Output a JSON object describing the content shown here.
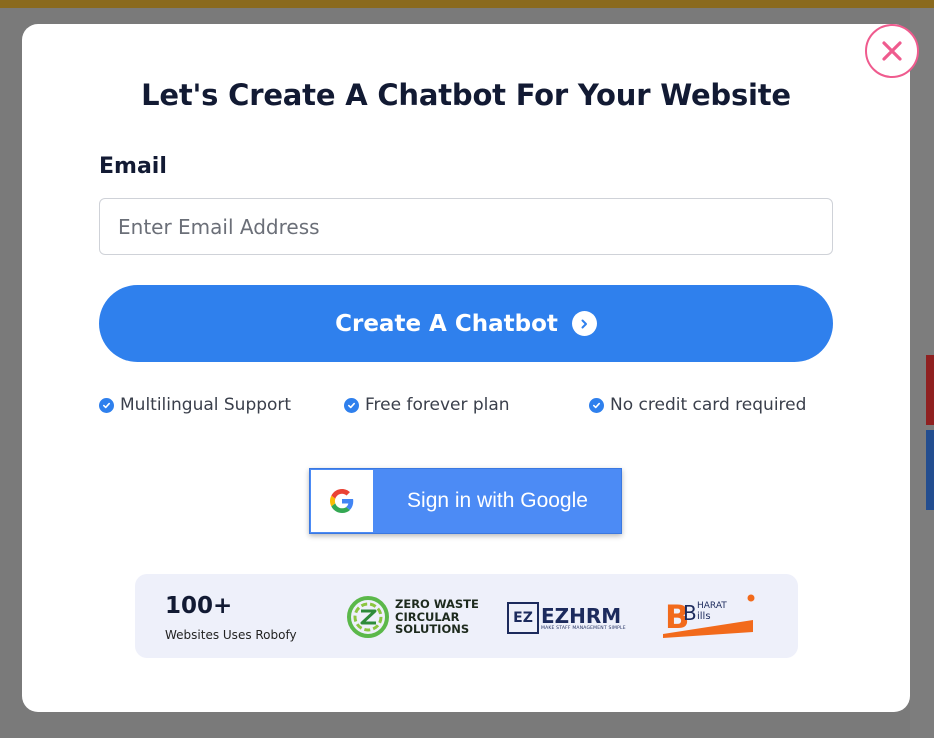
{
  "modal": {
    "title": "Let's Create A Chatbot For Your Website",
    "email_label": "Email",
    "email_placeholder": "Enter Email Address",
    "email_value": "",
    "cta_label": "Create A Chatbot",
    "cta_icon": "chevron-right-circle-icon",
    "close_icon": "close-icon",
    "features": [
      {
        "label": "Multilingual Support",
        "icon": "check-circle-icon"
      },
      {
        "label": "Free forever plan",
        "icon": "check-circle-icon"
      },
      {
        "label": "No credit card required",
        "icon": "check-circle-icon"
      }
    ],
    "google_button_label": "Sign in with Google",
    "trust": {
      "count": "100+",
      "caption": "Websites Uses Robofy",
      "logos": [
        {
          "name": "zero-waste",
          "lines": [
            "ZERO WASTE",
            "CIRCULAR",
            "SOLUTIONS"
          ]
        },
        {
          "name": "ezhrm",
          "text": "EZHRM",
          "badge": "EZ",
          "tagline": "MAKE STAFF MANAGEMENT SIMPLE"
        },
        {
          "name": "bharat-bills",
          "text": "BHARAT Bills"
        }
      ]
    }
  },
  "colors": {
    "primary": "#2f80ed",
    "close_accent": "#ef5b8e",
    "heading": "#121a33",
    "trust_bg": "#eef0fa",
    "google_blue": "#4c8bf5"
  }
}
